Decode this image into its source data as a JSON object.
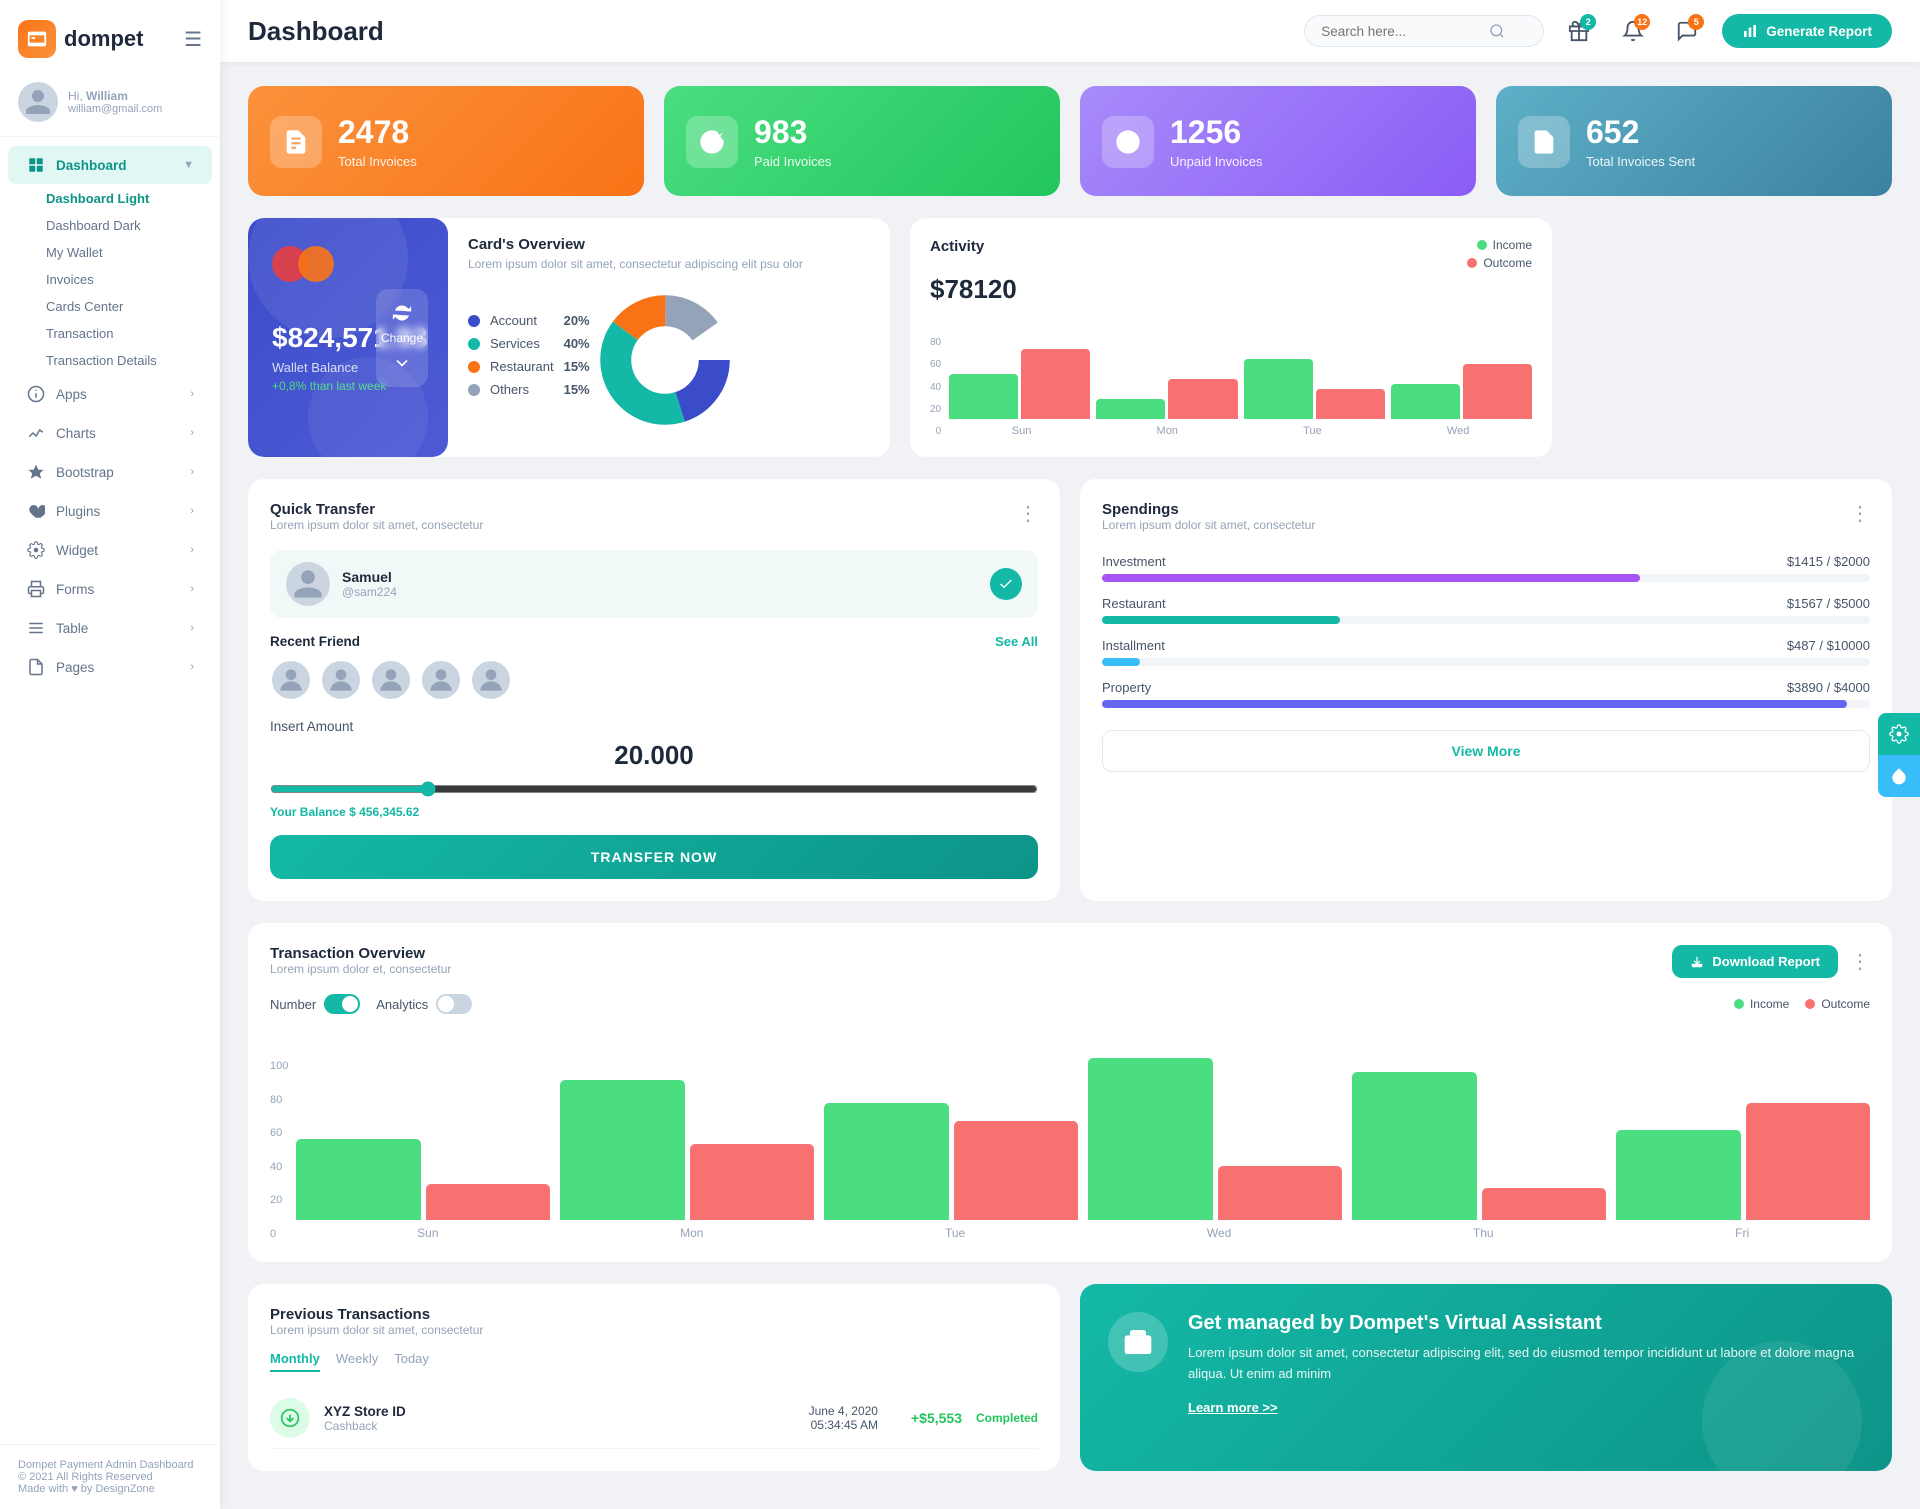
{
  "sidebar": {
    "logo": "dompet",
    "hamburger": "☰",
    "user": {
      "greeting": "Hi,",
      "name": "William",
      "email": "william@gmail.com"
    },
    "nav": [
      {
        "id": "dashboard",
        "label": "Dashboard",
        "icon": "grid",
        "active": true,
        "hasArrow": true,
        "submenu": [
          {
            "label": "Dashboard Light",
            "active": true
          },
          {
            "label": "Dashboard Dark",
            "active": false
          },
          {
            "label": "My Wallet",
            "active": false
          },
          {
            "label": "Invoices",
            "active": false
          },
          {
            "label": "Cards Center",
            "active": false
          },
          {
            "label": "Transaction",
            "active": false
          },
          {
            "label": "Transaction Details",
            "active": false
          }
        ]
      },
      {
        "id": "apps",
        "label": "Apps",
        "icon": "info",
        "active": false,
        "hasArrow": true
      },
      {
        "id": "charts",
        "label": "Charts",
        "icon": "chart",
        "active": false,
        "hasArrow": true
      },
      {
        "id": "bootstrap",
        "label": "Bootstrap",
        "icon": "star",
        "active": false,
        "hasArrow": true
      },
      {
        "id": "plugins",
        "label": "Plugins",
        "icon": "heart",
        "active": false,
        "hasArrow": true
      },
      {
        "id": "widget",
        "label": "Widget",
        "icon": "gear",
        "active": false,
        "hasArrow": true
      },
      {
        "id": "forms",
        "label": "Forms",
        "icon": "printer",
        "active": false,
        "hasArrow": true
      },
      {
        "id": "table",
        "label": "Table",
        "icon": "list",
        "active": false,
        "hasArrow": true
      },
      {
        "id": "pages",
        "label": "Pages",
        "icon": "document",
        "active": false,
        "hasArrow": true
      }
    ],
    "footer": {
      "company": "Dompet Payment Admin Dashboard",
      "copyright": "© 2021 All Rights Reserved",
      "made_with": "Made with ♥ by DesignZone"
    }
  },
  "header": {
    "title": "Dashboard",
    "search_placeholder": "Search here...",
    "notifications": [
      {
        "badge": "2",
        "type": "gift"
      },
      {
        "badge": "12",
        "type": "bell"
      },
      {
        "badge": "5",
        "type": "chat"
      }
    ],
    "generate_btn": "Generate Report"
  },
  "stats": [
    {
      "id": "total-invoices",
      "number": "2478",
      "label": "Total Invoices",
      "color": "orange"
    },
    {
      "id": "paid-invoices",
      "number": "983",
      "label": "Paid Invoices",
      "color": "green"
    },
    {
      "id": "unpaid-invoices",
      "number": "1256",
      "label": "Unpaid Invoices",
      "color": "purple"
    },
    {
      "id": "total-sent",
      "number": "652",
      "label": "Total Invoices Sent",
      "color": "blue-gray"
    }
  ],
  "card_wallet": {
    "balance": "$824,571.93",
    "label": "Wallet Balance",
    "growth": "+0,8% than last week",
    "change_btn": "Change"
  },
  "card_overview": {
    "title": "Card's Overview",
    "subtitle": "Lorem ipsum dolor sit amet, consectetur adipiscing elit psu olor",
    "categories": [
      {
        "label": "Account",
        "pct": "20%",
        "color": "#3b4cca"
      },
      {
        "label": "Services",
        "pct": "40%",
        "color": "#14b8a6"
      },
      {
        "label": "Restaurant",
        "pct": "15%",
        "color": "#f97316"
      },
      {
        "label": "Others",
        "pct": "15%",
        "color": "#94a3b8"
      }
    ]
  },
  "activity": {
    "title": "Activity",
    "amount": "$78120",
    "legend": [
      {
        "label": "Income",
        "color": "#4ade80"
      },
      {
        "label": "Outcome",
        "color": "#f87171"
      }
    ],
    "bars": [
      {
        "day": "Sun",
        "income": 45,
        "outcome": 70
      },
      {
        "day": "Mon",
        "income": 20,
        "outcome": 40
      },
      {
        "day": "Tue",
        "income": 60,
        "outcome": 30
      },
      {
        "day": "Wed",
        "income": 35,
        "outcome": 55
      }
    ]
  },
  "quick_transfer": {
    "title": "Quick Transfer",
    "subtitle": "Lorem ipsum dolor sit amet, consectetur",
    "selected_user": {
      "name": "Samuel",
      "handle": "@sam224"
    },
    "recent_friends_label": "Recent Friend",
    "see_all": "See All",
    "insert_amount_label": "Insert Amount",
    "amount": "20.000",
    "balance_label": "Your Balance",
    "balance_value": "$ 456,345.62",
    "transfer_btn": "TRANSFER NOW"
  },
  "spendings": {
    "title": "Spendings",
    "subtitle": "Lorem ipsum dolor sit amet, consectetur",
    "items": [
      {
        "label": "Investment",
        "current": "$1415",
        "max": "$2000",
        "pct": 70,
        "color": "#a855f7"
      },
      {
        "label": "Restaurant",
        "current": "$1567",
        "max": "$5000",
        "pct": 31,
        "color": "#14b8a6"
      },
      {
        "label": "Installment",
        "current": "$487",
        "max": "$10000",
        "pct": 5,
        "color": "#38bdf8"
      },
      {
        "label": "Property",
        "current": "$3890",
        "max": "$4000",
        "pct": 97,
        "color": "#6366f1"
      }
    ],
    "view_more_btn": "View More"
  },
  "transaction_overview": {
    "title": "Transaction Overview",
    "subtitle": "Lorem ipsum dolor et, consectetur",
    "download_btn": "Download Report",
    "toggle_number": {
      "label": "Number",
      "on": true
    },
    "toggle_analytics": {
      "label": "Analytics",
      "on": false
    },
    "legend": [
      {
        "label": "Income",
        "color": "#4ade80"
      },
      {
        "label": "Outcome",
        "color": "#f87171"
      }
    ],
    "bars": [
      {
        "day": "Sun",
        "income": 45,
        "outcome": 20
      },
      {
        "day": "Mon",
        "income": 78,
        "outcome": 42
      },
      {
        "day": "Tue",
        "income": 65,
        "outcome": 55
      },
      {
        "day": "Wed",
        "income": 90,
        "outcome": 30
      },
      {
        "day": "Thu",
        "income": 82,
        "outcome": 18
      },
      {
        "day": "Fri",
        "income": 50,
        "outcome": 65
      }
    ],
    "y_axis": [
      "100",
      "80",
      "60",
      "40",
      "20",
      "0"
    ]
  },
  "prev_transactions": {
    "title": "Previous Transactions",
    "subtitle": "Lorem ipsum dolor sit amet, consectetur",
    "tabs": [
      "Monthly",
      "Weekly",
      "Today"
    ],
    "active_tab": "Monthly",
    "items": [
      {
        "name": "XYZ Store ID",
        "type": "Cashback",
        "date": "June 4, 2020",
        "time": "05:34:45 AM",
        "amount": "+$5,553",
        "status": "Completed"
      }
    ]
  },
  "virtual_assistant": {
    "title": "Get managed by Dompet's Virtual Assistant",
    "description": "Lorem ipsum dolor sit amet, consectetur adipiscing elit, sed do eiusmod tempor incididunt ut labore et dolore magna aliqua. Ut enim ad minim",
    "link": "Learn more >>"
  }
}
